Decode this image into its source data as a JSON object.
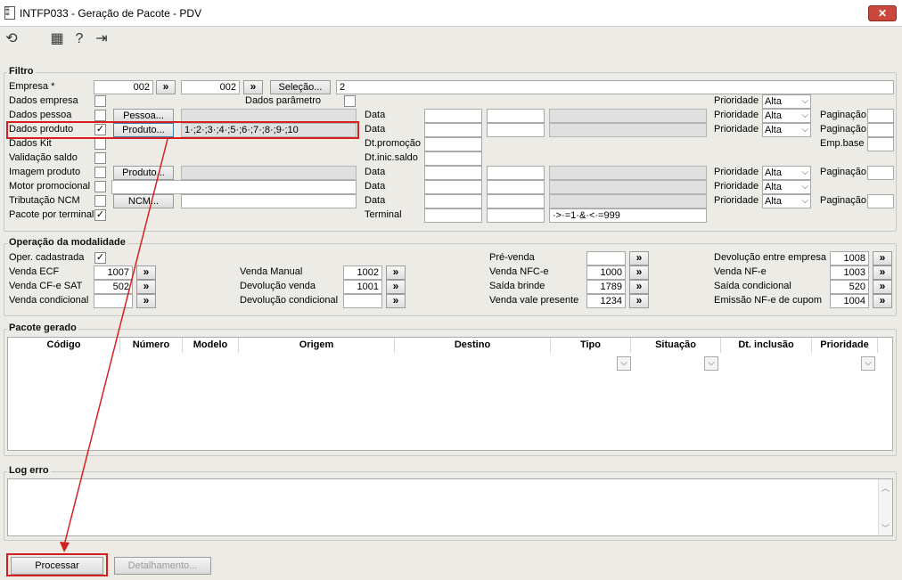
{
  "window": {
    "title": "INTFP033 - Geração de Pacote - PDV",
    "close_label": "✕"
  },
  "filtro": {
    "title": "Filtro",
    "empresa_label": "Empresa *",
    "empresa_from": "002",
    "empresa_to": "002",
    "arrow_label": "»",
    "selecao_button": "Seleção...",
    "selecao_value": "2",
    "dados_empresa": "Dados empresa",
    "dados_parametro": "Dados parâmetro",
    "dados_pessoa": "Dados pessoa",
    "pessoa_button": "Pessoa...",
    "dados_produto": "Dados produto",
    "produto_button": "Produto...",
    "produto_value": "1·;2·;3·;4·;5·;6·;7·;8·;9·;10",
    "dados_kit": "Dados Kit",
    "validacao_saldo": "Validação saldo",
    "imagem_produto": "Imagem produto",
    "imagem_produto_button": "Produto...",
    "motor_promocional": "Motor promocional",
    "tributacao_ncm": "Tributação NCM",
    "ncm_button": "NCM...",
    "pacote_terminal": "Pacote por terminal",
    "data_label": "Data",
    "dt_promocao": "Dt.promoção",
    "dt_inic_saldo": "Dt.inic.saldo",
    "terminal_label": "Terminal",
    "terminal_value": "·>·=1·&·<·=999",
    "prioridade_label": "Prioridade",
    "prioridade_value": "Alta",
    "paginacao_label": "Paginação",
    "emp_base_label": "Emp.base"
  },
  "operacao": {
    "title": "Operação da modalidade",
    "oper_cadastrada": "Oper. cadastrada",
    "venda_ecf": "Venda ECF",
    "venda_ecf_value": "1007",
    "venda_cfe_sat": "Venda CF-e SAT",
    "venda_cfe_sat_value": "502",
    "venda_condicional": "Venda condicional",
    "venda_manual": "Venda Manual",
    "venda_manual_value": "1002",
    "devolucao_venda": "Devolução venda",
    "devolucao_venda_value": "1001",
    "devolucao_condicional": "Devolução condicional",
    "pre_venda": "Pré-venda",
    "venda_nfce": "Venda NFC-e",
    "venda_nfce_value": "1000",
    "saida_brinde": "Saída brinde",
    "saida_brinde_value": "1789",
    "venda_vale_presente": "Venda vale presente",
    "venda_vale_presente_value": "1234",
    "devolucao_entre_empresa": "Devolução entre empresa",
    "devolucao_entre_empresa_value": "1008",
    "venda_nfe": "Venda NF-e",
    "venda_nfe_value": "1003",
    "saida_condicional": "Saída condicional",
    "saida_condicional_value": "520",
    "emissao_nfe_cupom": "Emissão NF-e de cupom",
    "emissao_nfe_cupom_value": "1004"
  },
  "pacote": {
    "title": "Pacote gerado",
    "columns": [
      "Código",
      "Número",
      "Modelo",
      "Origem",
      "Destino",
      "Tipo",
      "Situação",
      "Dt. inclusão",
      "Prioridade"
    ]
  },
  "log": {
    "title": "Log erro"
  },
  "footer": {
    "processar": "Processar",
    "detalhamento": "Detalhamento..."
  },
  "colors": {
    "highlight": "#d62020",
    "close": "#c9473c"
  }
}
